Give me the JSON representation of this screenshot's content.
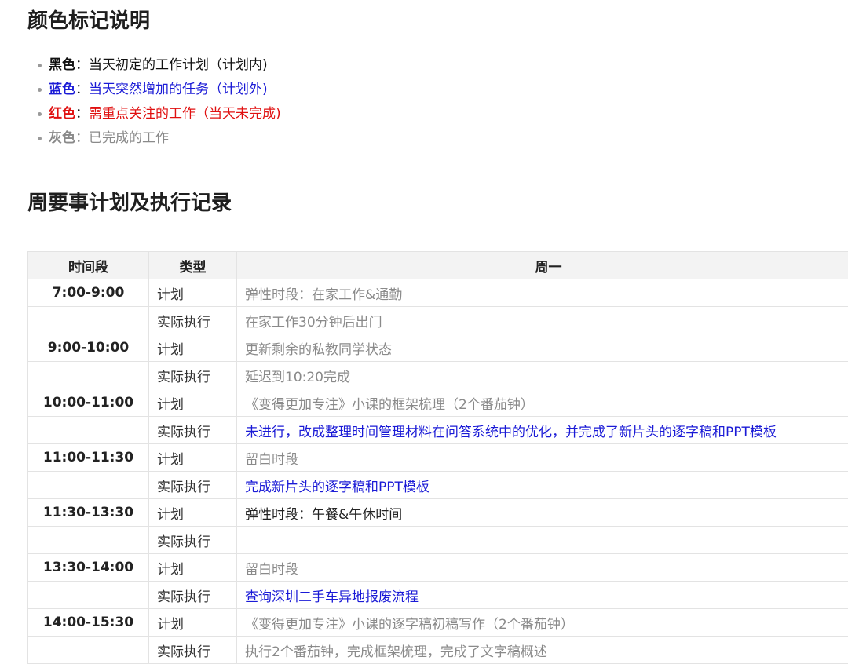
{
  "legend": {
    "title": "颜色标记说明",
    "items": [
      {
        "name": "黑色",
        "sep": "：",
        "desc": "当天初定的工作计划（计划内)",
        "color": "black"
      },
      {
        "name": "蓝色",
        "sep": "：",
        "desc": "当天突然增加的任务（计划外)",
        "color": "blue"
      },
      {
        "name": "红色",
        "sep": "：",
        "desc": "需重点关注的工作（当天未完成)",
        "color": "red"
      },
      {
        "name": "灰色",
        "sep": "：",
        "desc": "已完成的工作",
        "color": "gray"
      }
    ]
  },
  "plan": {
    "title": "周要事计划及执行记录",
    "headers": [
      "时间段",
      "类型",
      "周一"
    ],
    "rows": [
      {
        "time": "7:00-9:00",
        "type": "计划",
        "content": "弹性时段：在家工作&通勤",
        "color": "gray"
      },
      {
        "time": "",
        "type": "实际执行",
        "content": "在家工作30分钟后出门",
        "color": "gray"
      },
      {
        "time": "9:00-10:00",
        "type": "计划",
        "content": "更新剩余的私教同学状态",
        "color": "gray"
      },
      {
        "time": "",
        "type": "实际执行",
        "content": "延迟到10:20完成",
        "color": "gray"
      },
      {
        "time": "10:00-11:00",
        "type": "计划",
        "content": "《变得更加专注》小课的框架梳理（2个番茄钟）",
        "color": "gray"
      },
      {
        "time": "",
        "type": "实际执行",
        "content": "未进行，改成整理时间管理材料在问答系统中的优化，并完成了新片头的逐字稿和PPT模板",
        "color": "blue"
      },
      {
        "time": "11:00-11:30",
        "type": "计划",
        "content": "留白时段",
        "color": "gray"
      },
      {
        "time": "",
        "type": "实际执行",
        "content": "完成新片头的逐字稿和PPT模板",
        "color": "blue"
      },
      {
        "time": "11:30-13:30",
        "type": "计划",
        "content": "弹性时段：午餐&午休时间",
        "color": "black"
      },
      {
        "time": "",
        "type": "实际执行",
        "content": "",
        "color": "black"
      },
      {
        "time": "13:30-14:00",
        "type": "计划",
        "content": "留白时段",
        "color": "gray"
      },
      {
        "time": "",
        "type": "实际执行",
        "content": "查询深圳二手车异地报废流程",
        "color": "blue"
      },
      {
        "time": "14:00-15:30",
        "type": "计划",
        "content": "《变得更加专注》小课的逐字稿初稿写作（2个番茄钟）",
        "color": "gray"
      },
      {
        "time": "",
        "type": "实际执行",
        "content": "执行2个番茄钟，完成框架梳理，完成了文字稿概述",
        "color": "gray"
      }
    ]
  }
}
